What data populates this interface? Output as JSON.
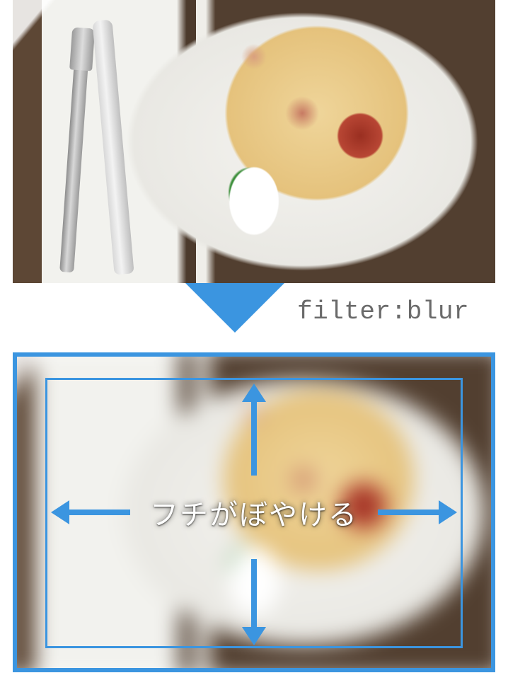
{
  "filter_label": "filter:blur",
  "overlay_caption": "フチがぼやける",
  "accent_color": "#3b95e0"
}
